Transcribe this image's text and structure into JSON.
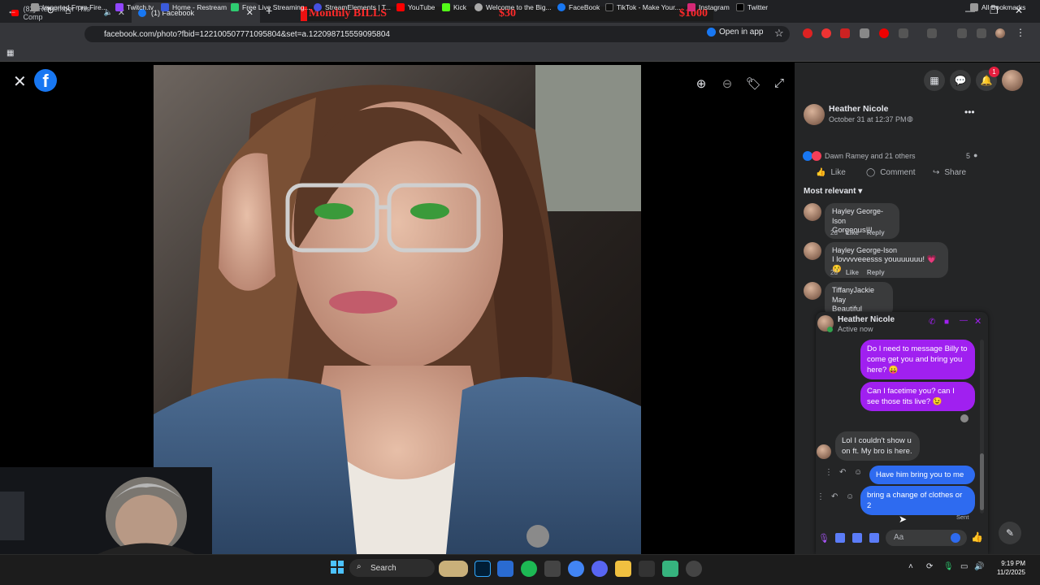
{
  "browser": {
    "tabs": [
      {
        "title": "(82) Remember This Comp",
        "active": false
      },
      {
        "title": "(1) Facebook",
        "active": true
      }
    ],
    "new_tab": "+",
    "url": "facebook.com/photo?fbid=122100507771095804&set=a.122098715559095804",
    "open_in_app": "Open in app",
    "bookmarks": [
      "Imported From Fire...",
      "Twitch.tv",
      "Home - Restream",
      "Free Live Streaming...",
      "StreamElements | T...",
      "YouTube",
      "Kick",
      "Welcome to the Big...",
      "FaceBook",
      "TikTok - Make Your...",
      "Instagram",
      "Twitter"
    ],
    "all_bookmarks": "All Bookmarks"
  },
  "overlay": {
    "label": "Monthly BILLS",
    "current": "$30",
    "goal": "$1000",
    "progress_fraction": 0.03,
    "color": "#ff2a2a"
  },
  "facebook": {
    "notifications_badge": "1",
    "post": {
      "author": "Heather Nicole",
      "date": "October 31 at 12:37 PM",
      "reactions_text": "Dawn Ramey and 21 others",
      "comments_count": "5",
      "actions": {
        "like": "Like",
        "comment": "Comment",
        "share": "Share"
      },
      "sort": "Most relevant"
    },
    "comments": [
      {
        "name": "Hayley George-Ison",
        "text": "Gorgeous!!!",
        "time": "2d",
        "like": "Like",
        "reply": "Reply"
      },
      {
        "name": "Hayley George-Ison",
        "text": "I lovvvveeesss youuuuuuu! 💗😚",
        "time": "2d",
        "like": "Like",
        "reply": "Reply"
      },
      {
        "name": "TiffanyJackie May",
        "text": "Beautiful",
        "time": "",
        "like": "",
        "reply": ""
      }
    ],
    "chat": {
      "name": "Heather Nicole",
      "status": "Active now",
      "messages": [
        {
          "dir": "out",
          "color": "purple",
          "text": "Do I need to message Billy to come get you and bring you here? 😛"
        },
        {
          "dir": "out",
          "color": "purple",
          "text": "Can I facetime you? can I see those tits live? 😉"
        },
        {
          "dir": "in",
          "text": "Lol I couldn't show u on ft. My bro is here."
        },
        {
          "dir": "out",
          "color": "blue",
          "text": "Have him bring you to me"
        },
        {
          "dir": "out",
          "color": "blue",
          "text": "bring a change of clothes or 2"
        }
      ],
      "sent_label": "Sent",
      "input_placeholder": "Aa"
    }
  },
  "taskbar": {
    "search": "Search",
    "time": "9:19 PM",
    "date": "11/2/2025"
  },
  "colors": {
    "fb_blue": "#1877f2",
    "purple_bubble": "#a020f0",
    "blue_bubble": "#2e6bf0",
    "panel_bg": "#242526"
  }
}
